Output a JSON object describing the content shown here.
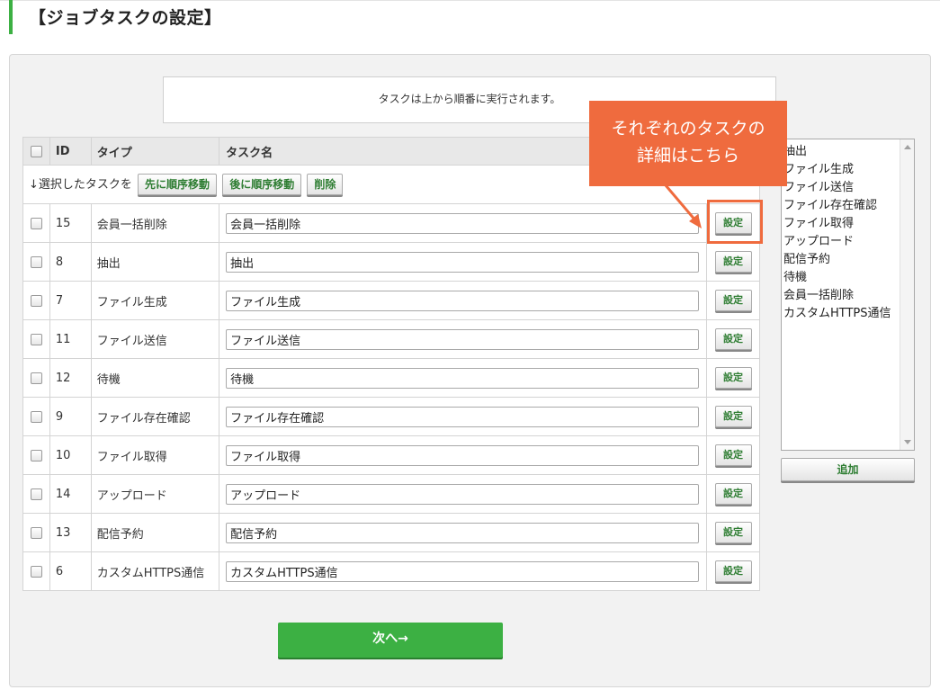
{
  "page": {
    "title": "【ジョブタスクの設定】"
  },
  "notice": "タスクは上から順番に実行されます。",
  "table": {
    "headers": {
      "id": "ID",
      "type": "タイプ",
      "name": "タスク名"
    },
    "action_bar": {
      "label": "↓選択したタスクを",
      "move_first": "先に順序移動",
      "move_after": "後に順序移動",
      "delete": "削除"
    },
    "settings_label": "設定",
    "rows": [
      {
        "id": "15",
        "type": "会員一括削除",
        "name": "会員一括削除"
      },
      {
        "id": "8",
        "type": "抽出",
        "name": "抽出"
      },
      {
        "id": "7",
        "type": "ファイル生成",
        "name": "ファイル生成"
      },
      {
        "id": "11",
        "type": "ファイル送信",
        "name": "ファイル送信"
      },
      {
        "id": "12",
        "type": "待機",
        "name": "待機"
      },
      {
        "id": "9",
        "type": "ファイル存在確認",
        "name": "ファイル存在確認"
      },
      {
        "id": "10",
        "type": "ファイル取得",
        "name": "ファイル取得"
      },
      {
        "id": "14",
        "type": "アップロード",
        "name": "アップロード"
      },
      {
        "id": "13",
        "type": "配信予約",
        "name": "配信予約"
      },
      {
        "id": "6",
        "type": "カスタムHTTPS通信",
        "name": "カスタムHTTPS通信"
      }
    ]
  },
  "task_types": [
    "抽出",
    "ファイル生成",
    "ファイル送信",
    "ファイル存在確認",
    "ファイル取得",
    "アップロード",
    "配信予約",
    "待機",
    "会員一括削除",
    "カスタムHTTPS通信"
  ],
  "add_label": "追加",
  "next_label": "次へ→",
  "callout": {
    "line1": "それぞれのタスクの",
    "line2": "詳細はこちら"
  },
  "colors": {
    "accent_green": "#3cb043",
    "callout_orange": "#ef6b3e"
  }
}
